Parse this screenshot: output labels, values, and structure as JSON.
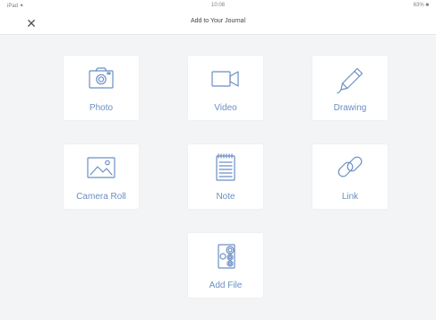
{
  "status": {
    "carrier": "iPad ✦",
    "time": "10:08",
    "battery": "63% ■"
  },
  "nav": {
    "close": "✕",
    "title": "Add to Your Journal"
  },
  "tiles": [
    {
      "label": "Photo",
      "icon": "camera-icon"
    },
    {
      "label": "Video",
      "icon": "video-camera-icon"
    },
    {
      "label": "Drawing",
      "icon": "pencil-icon"
    },
    {
      "label": "Camera Roll",
      "icon": "image-icon"
    },
    {
      "label": "Note",
      "icon": "notepad-icon"
    },
    {
      "label": "Link",
      "icon": "chain-link-icon"
    },
    {
      "label": "Add File",
      "icon": "file-icon"
    }
  ],
  "colors": {
    "accent": "#6a8fc4",
    "background": "#f3f4f6",
    "tile": "#ffffff"
  }
}
